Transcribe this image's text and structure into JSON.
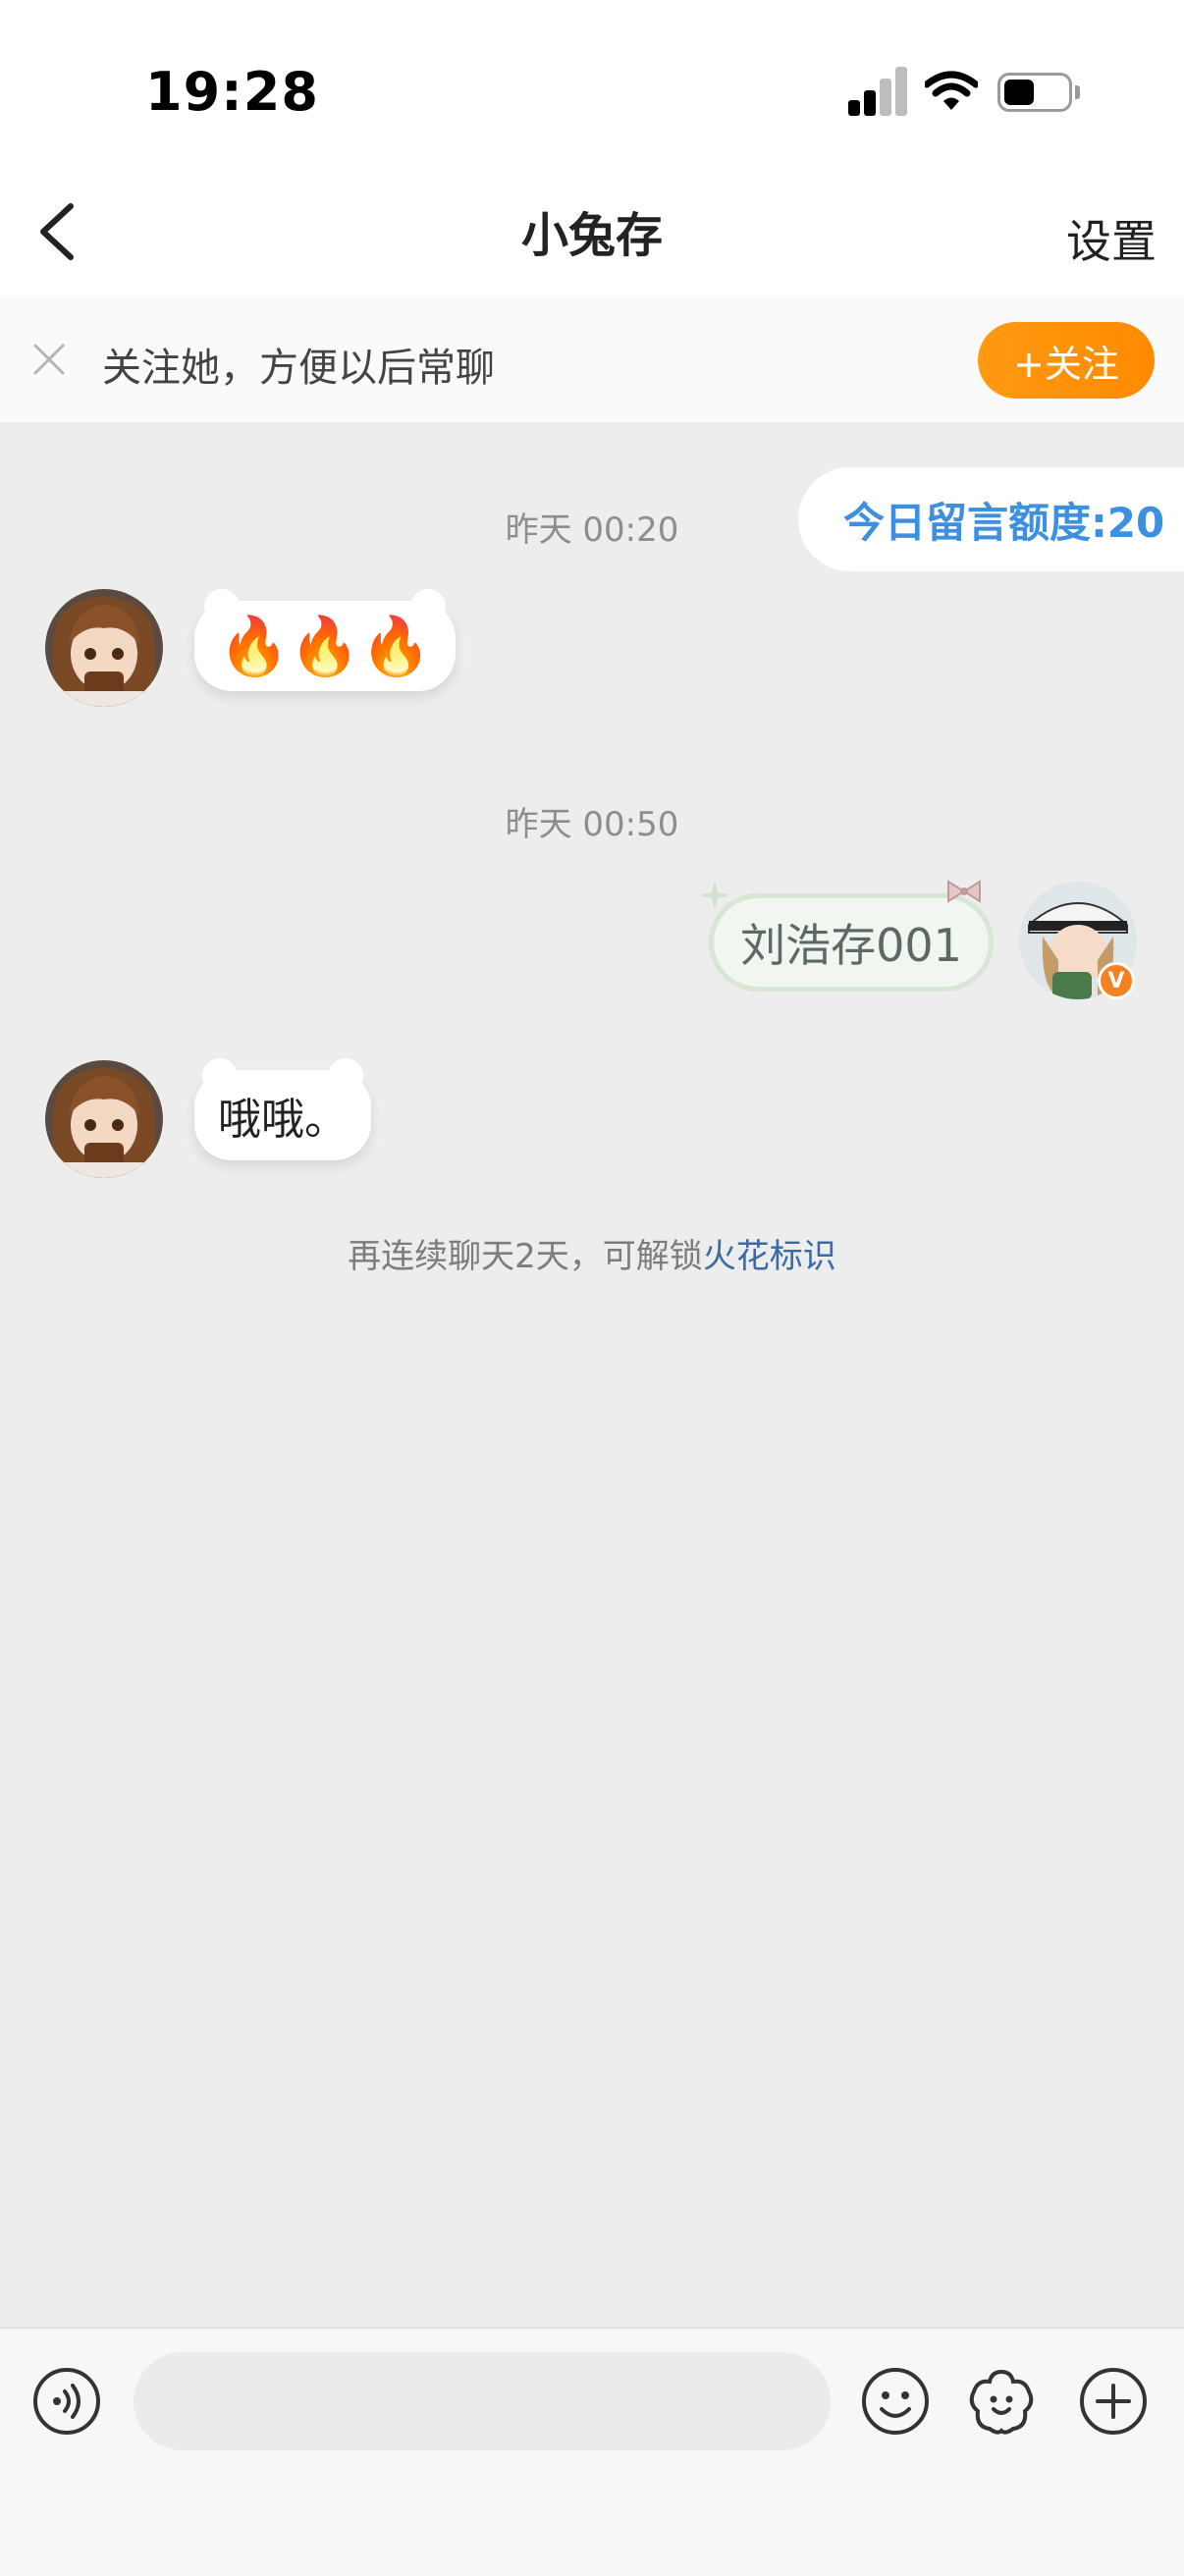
{
  "status_bar": {
    "time": "19:28"
  },
  "nav": {
    "title": "小兔存",
    "settings_label": "设置"
  },
  "follow_banner": {
    "text": "关注她，方便以后常聊",
    "button_label": "+关注"
  },
  "messages": {
    "quota": "今日留言额度:20",
    "timestamp_1": "昨天 00:20",
    "received_1": "🔥🔥🔥",
    "timestamp_2": "昨天 00:50",
    "sent_1": "刘浩存001",
    "received_2": "哦哦。"
  },
  "unlock_hint": {
    "text": "再连续聊天2天，可解锁",
    "link": "火花标识"
  },
  "colors": {
    "accent": "#ff9a12",
    "link": "#3b6aa8",
    "quota_blue": "#3d8fe0",
    "background": "#ededed"
  }
}
